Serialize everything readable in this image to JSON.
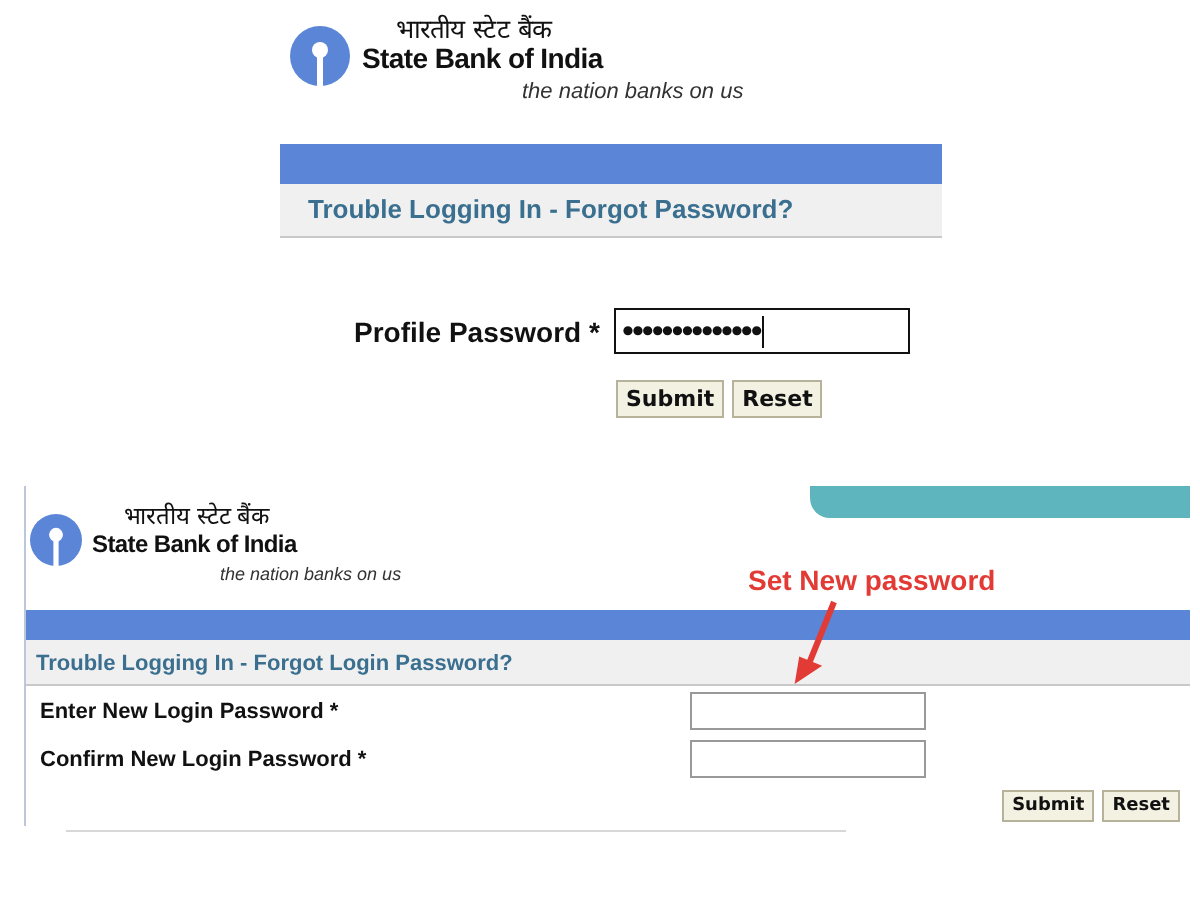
{
  "forgot_password_panel": {
    "logo": {
      "hindi_name": "भारतीय स्टेट बैंक",
      "name": "State Bank of India",
      "tagline": "the nation banks on us"
    },
    "title": "Trouble Logging In - Forgot Password?",
    "fields": [
      {
        "label": "Profile Password *",
        "value": "••••••••••••••",
        "focused": true
      }
    ],
    "buttons": [
      "Submit",
      "Reset"
    ]
  },
  "new_password_panel": {
    "logo": {
      "hindi_name": "भारतीय स्टेट बैंक",
      "name": "State Bank of India",
      "tagline": "the nation banks on us"
    },
    "annotation": "Set New password",
    "title": "Trouble Logging In - Forgot Login Password?",
    "fields": [
      {
        "label": "Enter New Login Password *",
        "focused": false
      },
      {
        "label": "Confirm New Login Password *",
        "focused": false
      }
    ],
    "buttons": [
      "Submit",
      "Reset"
    ]
  }
}
